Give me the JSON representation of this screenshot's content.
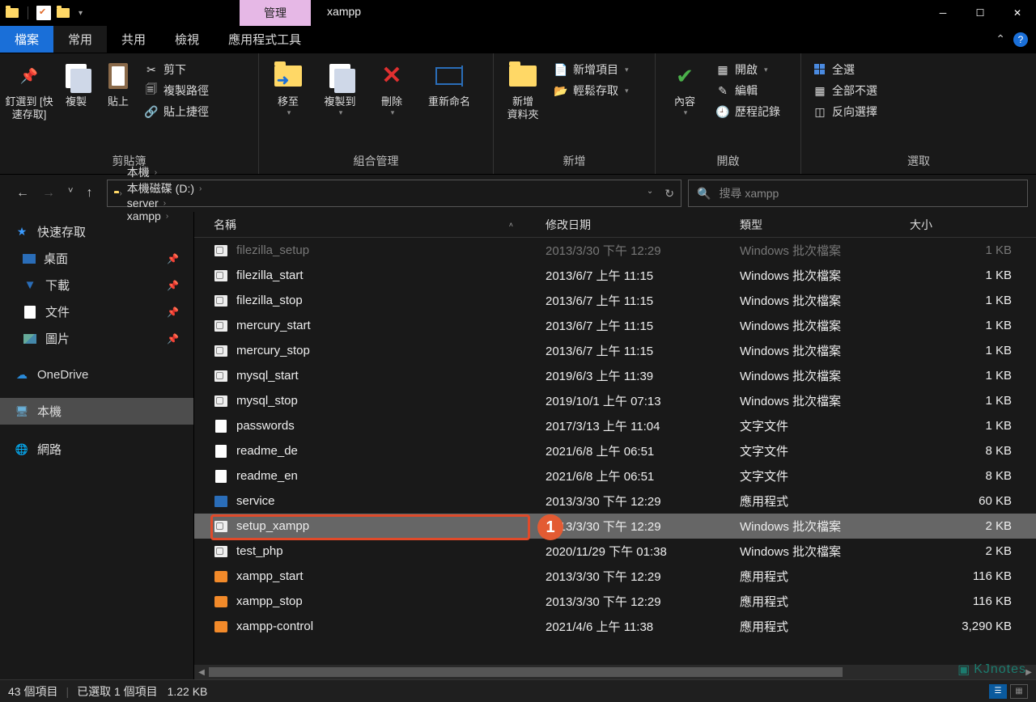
{
  "title_tab": "管理",
  "window_title": "xampp",
  "ribbon_tabs": {
    "file": "檔案",
    "home": "常用",
    "share": "共用",
    "view": "檢視",
    "app": "應用程式工具"
  },
  "ribbon": {
    "g1": {
      "pin": "釘選到 [快速存取]",
      "copy": "複製",
      "paste": "貼上",
      "cut": "剪下",
      "copypath": "複製路徑",
      "pastelnk": "貼上捷徑",
      "label": "剪貼簿"
    },
    "g2": {
      "moveto": "移至",
      "copyto": "複製到",
      "delete": "刪除",
      "rename": "重新命名",
      "label": "組合管理"
    },
    "g3": {
      "newfolder": "新增\n資料夾",
      "newitem": "新增項目",
      "easyaccess": "輕鬆存取",
      "label": "新增"
    },
    "g4": {
      "props": "內容",
      "open": "開啟",
      "edit": "編輯",
      "history": "歷程記錄",
      "label": "開啟"
    },
    "g5": {
      "selall": "全選",
      "selnone": "全部不選",
      "selinv": "反向選擇",
      "label": "選取"
    }
  },
  "breadcrumbs": [
    "本機",
    "本機磁碟 (D:)",
    "server",
    "xampp"
  ],
  "search_placeholder": "搜尋 xampp",
  "sidebar": {
    "quick": "快速存取",
    "desktop": "桌面",
    "downloads": "下載",
    "documents": "文件",
    "pictures": "圖片",
    "onedrive": "OneDrive",
    "thispc": "本機",
    "network": "網路"
  },
  "columns": {
    "name": "名稱",
    "date": "修改日期",
    "type": "類型",
    "size": "大小"
  },
  "files": [
    {
      "icon": "bat",
      "name": "filezilla_setup",
      "date": "2013/3/30 下午 12:29",
      "type": "Windows 批次檔案",
      "size": "1 KB",
      "cut": true
    },
    {
      "icon": "bat",
      "name": "filezilla_start",
      "date": "2013/6/7 上午 11:15",
      "type": "Windows 批次檔案",
      "size": "1 KB"
    },
    {
      "icon": "bat",
      "name": "filezilla_stop",
      "date": "2013/6/7 上午 11:15",
      "type": "Windows 批次檔案",
      "size": "1 KB"
    },
    {
      "icon": "bat",
      "name": "mercury_start",
      "date": "2013/6/7 上午 11:15",
      "type": "Windows 批次檔案",
      "size": "1 KB"
    },
    {
      "icon": "bat",
      "name": "mercury_stop",
      "date": "2013/6/7 上午 11:15",
      "type": "Windows 批次檔案",
      "size": "1 KB"
    },
    {
      "icon": "bat",
      "name": "mysql_start",
      "date": "2019/6/3 上午 11:39",
      "type": "Windows 批次檔案",
      "size": "1 KB"
    },
    {
      "icon": "bat",
      "name": "mysql_stop",
      "date": "2019/10/1 上午 07:13",
      "type": "Windows 批次檔案",
      "size": "1 KB"
    },
    {
      "icon": "txt",
      "name": "passwords",
      "date": "2017/3/13 上午 11:04",
      "type": "文字文件",
      "size": "1 KB"
    },
    {
      "icon": "txt",
      "name": "readme_de",
      "date": "2021/6/8 上午 06:51",
      "type": "文字文件",
      "size": "8 KB"
    },
    {
      "icon": "txt",
      "name": "readme_en",
      "date": "2021/6/8 上午 06:51",
      "type": "文字文件",
      "size": "8 KB"
    },
    {
      "icon": "exe",
      "name": "service",
      "date": "2013/3/30 下午 12:29",
      "type": "應用程式",
      "size": "60 KB"
    },
    {
      "icon": "bat",
      "name": "setup_xampp",
      "date": "2013/3/30 下午 12:29",
      "type": "Windows 批次檔案",
      "size": "2 KB",
      "selected": true
    },
    {
      "icon": "bat",
      "name": "test_php",
      "date": "2020/11/29 下午 01:38",
      "type": "Windows 批次檔案",
      "size": "2 KB"
    },
    {
      "icon": "xampp",
      "name": "xampp_start",
      "date": "2013/3/30 下午 12:29",
      "type": "應用程式",
      "size": "116 KB"
    },
    {
      "icon": "xampp",
      "name": "xampp_stop",
      "date": "2013/3/30 下午 12:29",
      "type": "應用程式",
      "size": "116 KB"
    },
    {
      "icon": "xampp",
      "name": "xampp-control",
      "date": "2021/4/6 上午 11:38",
      "type": "應用程式",
      "size": "3,290 KB"
    }
  ],
  "status": {
    "items": "43 個項目",
    "selected": "已選取 1 個項目",
    "size": "1.22 KB"
  },
  "annotation": {
    "badge": "1"
  },
  "watermark": "KJnotes"
}
